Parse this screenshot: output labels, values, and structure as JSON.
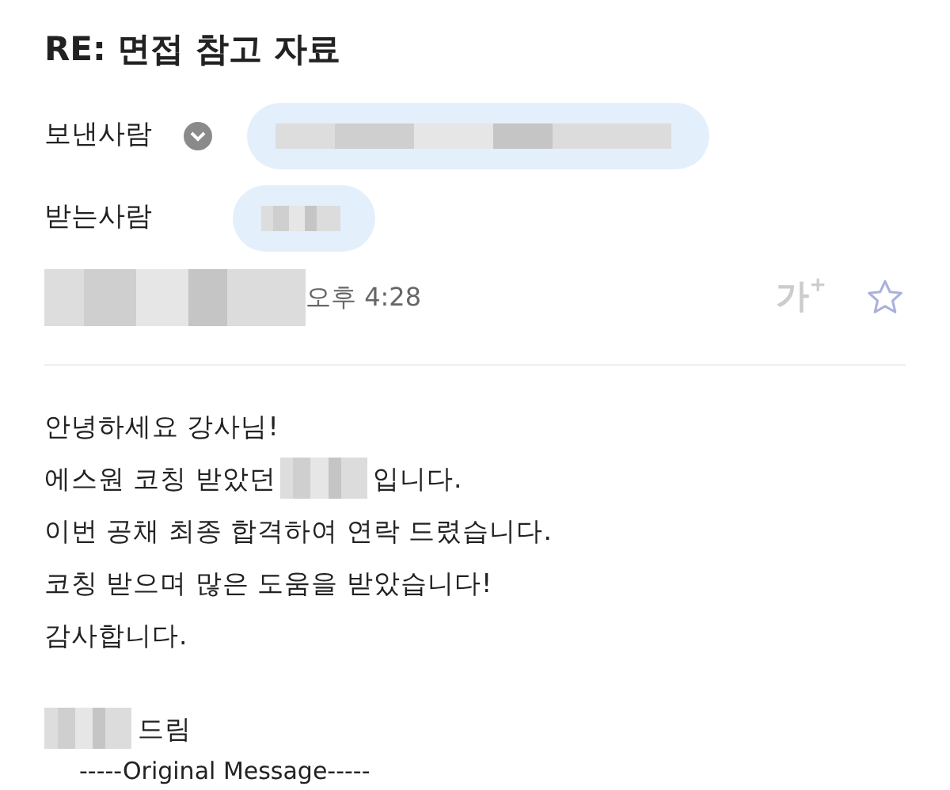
{
  "subject": "RE: 면접 참고 자료",
  "sender": {
    "label": "보낸사람",
    "expanded": false
  },
  "recipient": {
    "label": "받는사람"
  },
  "date": {
    "time": "오후 4:28"
  },
  "toolbar": {
    "font_size": "가",
    "font_plus": "+",
    "starred": false
  },
  "body": [
    [
      {
        "kind": "text",
        "text": "안녕하세요 강사님!"
      }
    ],
    [
      {
        "kind": "text",
        "text": "에스원 코칭 받았던"
      },
      {
        "kind": "redacted"
      },
      {
        "kind": "text",
        "text": "입니다."
      }
    ],
    [
      {
        "kind": "text",
        "text": "이번 공채 최종 합격하여 연락 드렸습니다."
      }
    ],
    [
      {
        "kind": "text",
        "text": "코칭 받으며 많은 도움을 받았습니다!"
      }
    ],
    [
      {
        "kind": "text",
        "text": "감사합니다."
      }
    ]
  ],
  "signature": [
    {
      "kind": "redacted"
    },
    {
      "kind": "text",
      "text": "드림"
    }
  ],
  "quote_header": "-----Original Message-----"
}
